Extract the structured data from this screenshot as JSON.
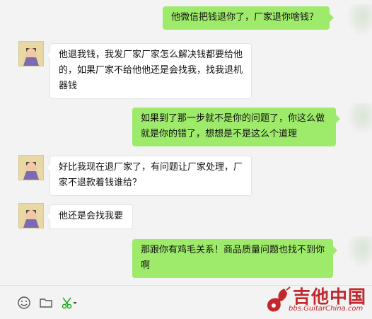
{
  "messages": [
    {
      "side": "right",
      "text": "他微信把钱退你了，厂家退你啥钱？"
    },
    {
      "side": "left",
      "text": "他退我钱，我发厂家厂家怎么解决钱都要给他的，如果厂家不给他他还是会找我，找我退机器钱"
    },
    {
      "side": "right",
      "text": "如果到了那一步就不是你的问题了，你这么做就是你的错了，想想是不是这么个道理"
    },
    {
      "side": "left",
      "text": "好比我现在退厂家了，有问题让厂家处理，厂家不退款着钱谁给？"
    },
    {
      "side": "left",
      "text": "他还是会找我要"
    },
    {
      "side": "right",
      "text": "那跟你有鸡毛关系！商品质量问题也找不到你啊"
    }
  ],
  "toolbar": {
    "icons": [
      "emoji-icon",
      "folder-icon",
      "scissors-icon",
      "dropdown-arrow-icon"
    ],
    "accent": "#1aad19"
  },
  "watermark": {
    "title": "吉他中国",
    "url": "bbs.GuitarChina.com",
    "color": "#c1272d"
  },
  "colors": {
    "bubble_right": "#9eea6a",
    "bubble_left": "#ffffff",
    "background": "#f3f3f3"
  }
}
